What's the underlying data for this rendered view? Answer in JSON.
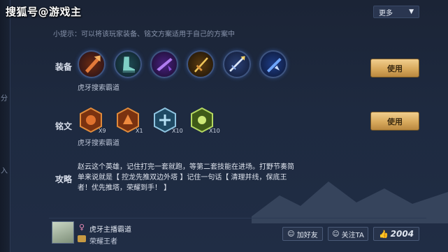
{
  "watermark": "搜狐号@游戏主",
  "header": {
    "more_label": "更多",
    "more_icon": "chevron-down"
  },
  "tip": "小提示：可以将该玩家装备、铭文方案适用于自己的方案中",
  "left_strip": {
    "frag1": "分",
    "frag2": "入"
  },
  "equipment": {
    "label": "装备",
    "items": [
      {
        "name": "axe-item",
        "color": "#c2501e"
      },
      {
        "name": "boots-item",
        "color": "#3a8f8a"
      },
      {
        "name": "purple-blade-item",
        "color": "#7a3ec6"
      },
      {
        "name": "golden-sword-item",
        "color": "#c79030"
      },
      {
        "name": "silver-spear-item",
        "color": "#6f8fd8"
      },
      {
        "name": "blue-blade-item",
        "color": "#3e6bd8"
      }
    ],
    "source": "虎牙搜索霸道",
    "use_label": "使用"
  },
  "runes": {
    "label": "铭文",
    "items": [
      {
        "count": "X9",
        "color": "#d0642a"
      },
      {
        "count": "X1",
        "color": "#d0642a"
      },
      {
        "count": "X10",
        "color": "#5fa3c9"
      },
      {
        "count": "X10",
        "color": "#8cbf3d"
      }
    ],
    "source": "虎牙搜索霸道",
    "use_label": "使用"
  },
  "strategy": {
    "label": "攻略",
    "text": "赵云这个英雄，记住打完一套就跑，等第二套技能在进场。打野节奏简单来说就是【 控龙先推双边外塔 】记住一句话【 清理并线，保底王者！优先推塔，荣耀到手！ 】"
  },
  "author": {
    "name": "虎牙主播霸道",
    "rank": "荣耀王者",
    "gender_icon": "female-icon",
    "add_friend": "加好友",
    "follow": "关注TA",
    "likes": "2004"
  }
}
